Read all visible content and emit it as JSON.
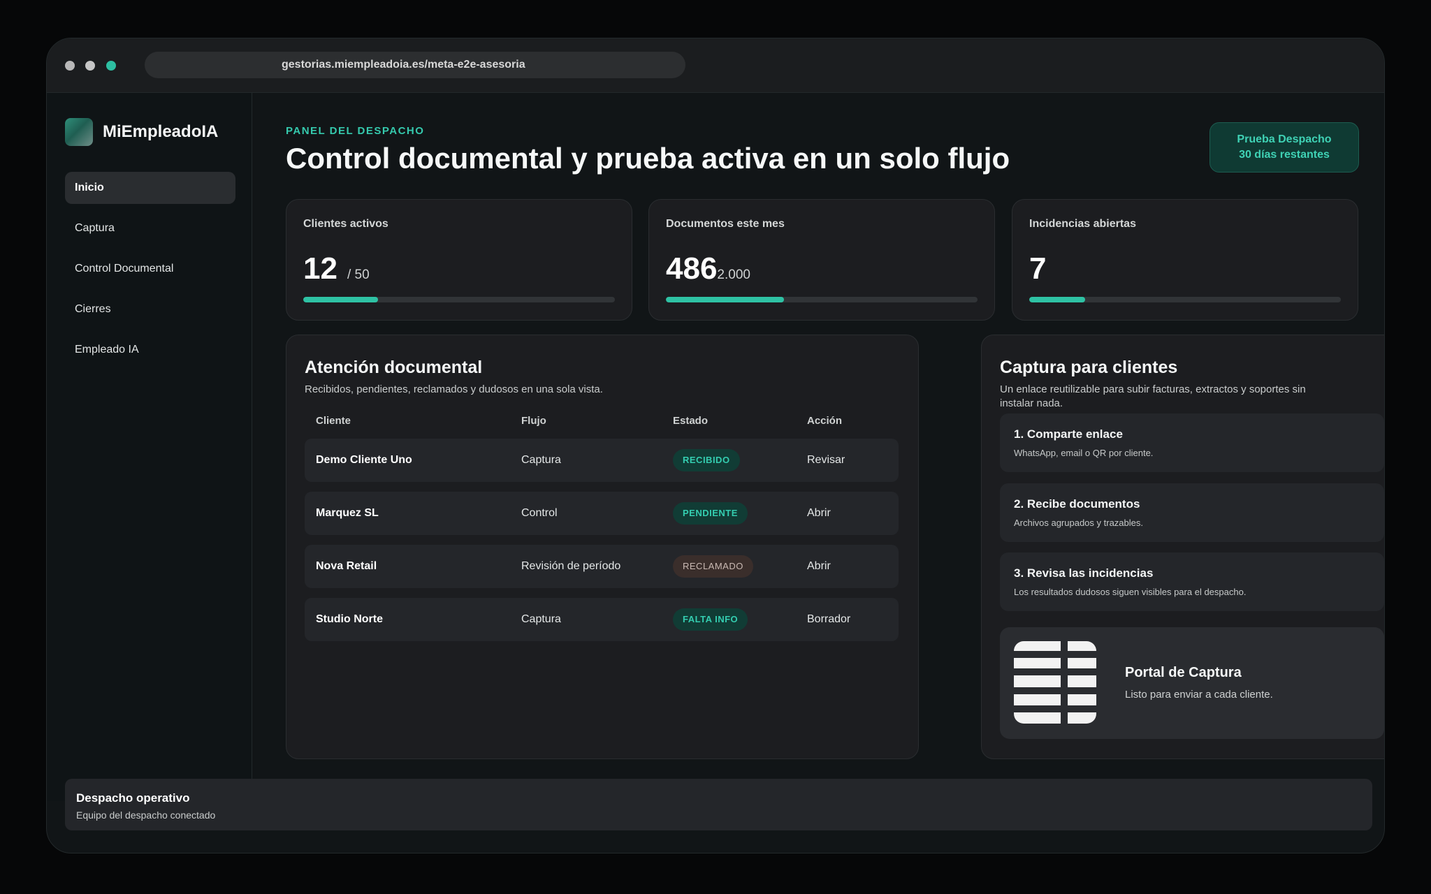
{
  "browser": {
    "url": "gestorias.miempleadoia.es/meta-e2e-asesoria"
  },
  "brand": {
    "name": "MiEmpleadoIA"
  },
  "nav": [
    {
      "label": "Inicio",
      "active": true
    },
    {
      "label": "Captura"
    },
    {
      "label": "Control Documental"
    },
    {
      "label": "Cierres"
    },
    {
      "label": "Empleado IA"
    }
  ],
  "header": {
    "kicker": "PANEL DEL DESPACHO",
    "title": "Control documental y prueba activa en un solo flujo",
    "trial_line1": "Prueba Despacho",
    "trial_line2": "30 días restantes"
  },
  "stats": [
    {
      "label": "Clientes activos",
      "value": "12",
      "sub": "/ 50",
      "progress": 0.24
    },
    {
      "label": "Documentos este mes",
      "value": "486",
      "sub": "2.000",
      "progress": 0.38
    },
    {
      "label": "Incidencias abiertas",
      "value": "7",
      "sub": "",
      "progress": 0.18
    }
  ],
  "attention": {
    "title": "Atención documental",
    "subtitle": "Recibidos, pendientes, reclamados y dudosos en una sola vista.",
    "columns": [
      "Cliente",
      "Flujo",
      "Estado",
      "Acción"
    ],
    "rows": [
      {
        "client": "Demo Cliente Uno",
        "flow": "Captura",
        "state": "RECIBIDO",
        "action": "Revisar"
      },
      {
        "client": "Marquez SL",
        "flow": "Control",
        "state": "PENDIENTE",
        "action": "Abrir"
      },
      {
        "client": "Nova Retail",
        "flow": "Revisión de período",
        "state": "RECLAMADO",
        "action": "Abrir"
      },
      {
        "client": "Studio Norte",
        "flow": "Captura",
        "state": "FALTA INFO",
        "action": "Borrador"
      }
    ]
  },
  "capture": {
    "title": "Captura para clientes",
    "subtitle": "Un enlace reutilizable para subir facturas, extractos y soportes sin instalar nada.",
    "steps": [
      {
        "title": "1. Comparte enlace",
        "desc": "WhatsApp, email o QR por cliente."
      },
      {
        "title": "2. Recibe documentos",
        "desc": "Archivos agrupados y trazables."
      },
      {
        "title": "3. Revisa las incidencias",
        "desc": "Los resultados dudosos siguen visibles para el despacho."
      }
    ],
    "portal": {
      "title": "Portal de Captura",
      "desc": "Listo para enviar a cada cliente."
    }
  },
  "footer": {
    "title": "Despacho operativo",
    "subtitle": "Equipo del despacho conectado"
  },
  "colors": {
    "accent": "#2ec2a4",
    "background": "#111517",
    "card": "#1c1d20"
  }
}
